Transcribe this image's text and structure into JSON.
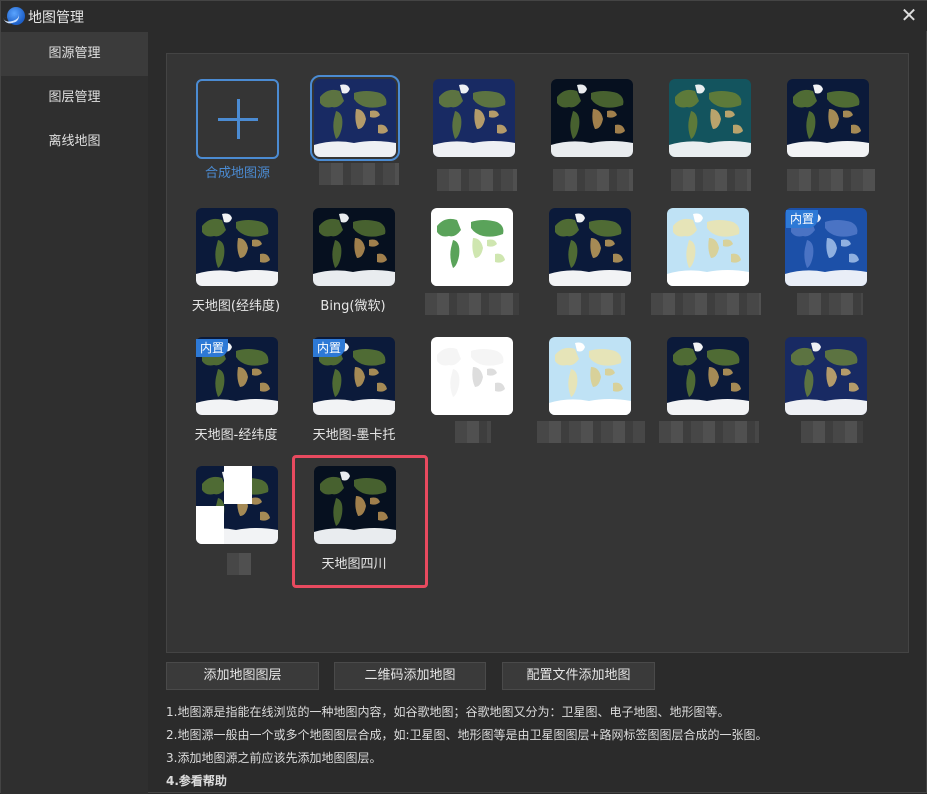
{
  "window": {
    "title": "地图管理",
    "close_glyph": "✕"
  },
  "sidebar": {
    "items": [
      {
        "label": "图源管理"
      },
      {
        "label": "图层管理"
      },
      {
        "label": "离线地图"
      }
    ]
  },
  "grid": {
    "add_label": "合成地图源",
    "badge_text": "内置",
    "tiles": [
      {
        "label": "天地图(经纬度)"
      },
      {
        "label": "Bing(微软)"
      },
      {
        "label": "天地图-经纬度"
      },
      {
        "label": "天地图-墨卡托"
      },
      {
        "label": "天地图四川"
      }
    ]
  },
  "buttons": {
    "add_layer": "添加地图图层",
    "qr_add": "二维码添加地图",
    "config_add": "配置文件添加地图"
  },
  "notes": {
    "line1": "1.地图源是指能在线浏览的一种地图内容，如谷歌地图；谷歌地图又分为：卫星图、电子地图、地形图等。",
    "line2": "2.地图源一般由一个或多个地图图层合成，如:卫星图、地形图等是由卫星图图层+路网标签图图层合成的一张图。",
    "line3": "3.添加地图源之前应该先添加地图图层。",
    "help": "4.参看帮助"
  },
  "colors": {
    "accent": "#4b8bd2",
    "highlight": "#e84a5f",
    "badge": "#2d79d6"
  }
}
